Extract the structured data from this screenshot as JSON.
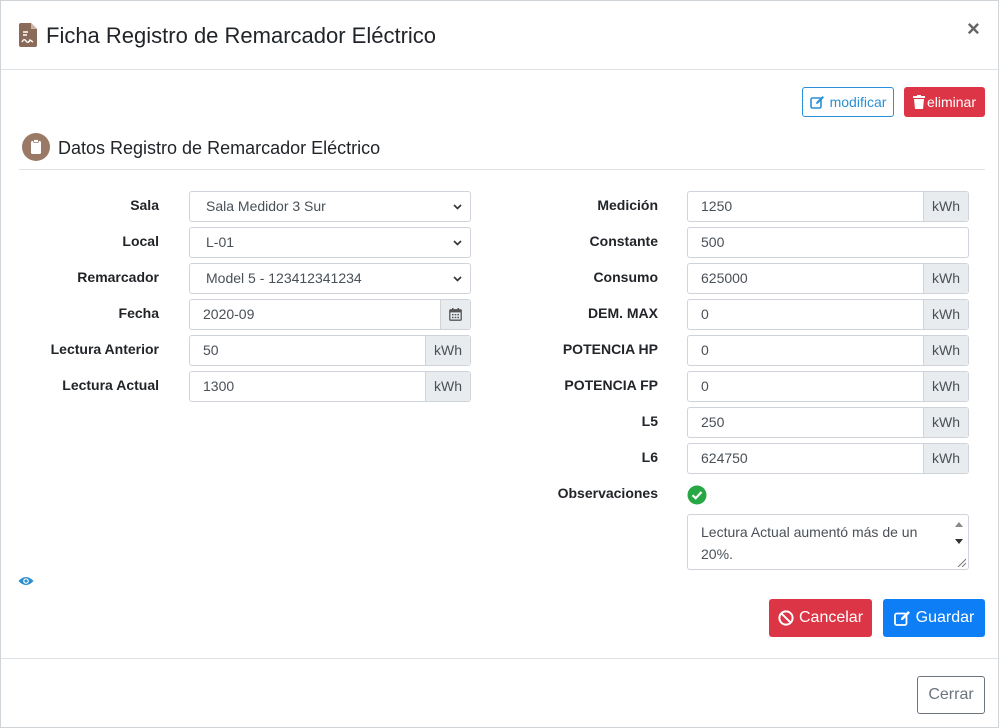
{
  "modal": {
    "title": "Ficha Registro de Remarcador Eléctrico",
    "close_symbol": "×",
    "title_icon": "file-signature-icon"
  },
  "actions": {
    "modify_label": "modificar",
    "delete_label": "eliminar"
  },
  "section": {
    "title": "Datos Registro de Remarcador Eléctrico",
    "icon": "clipboard-icon"
  },
  "left": {
    "sala": {
      "label": "Sala",
      "value": "Sala Medidor 3 Sur"
    },
    "local": {
      "label": "Local",
      "value": "L-01"
    },
    "remarcador": {
      "label": "Remarcador",
      "value": "Model 5 - 123412341234"
    },
    "fecha": {
      "label": "Fecha",
      "value": "2020-09"
    },
    "lectura_anterior": {
      "label": "Lectura Anterior",
      "value": "50",
      "unit": "kWh"
    },
    "lectura_actual": {
      "label": "Lectura Actual",
      "value": "1300",
      "unit": "kWh"
    }
  },
  "right": {
    "medicion": {
      "label": "Medición",
      "value": "1250",
      "unit": "kWh"
    },
    "constante": {
      "label": "Constante",
      "value": "500"
    },
    "consumo": {
      "label": "Consumo",
      "value": "625000",
      "unit": "kWh"
    },
    "dem_max": {
      "label": "DEM. MAX",
      "value": "0",
      "unit": "kWh"
    },
    "potencia_hp": {
      "label": "POTENCIA HP",
      "value": "0",
      "unit": "kWh"
    },
    "potencia_fp": {
      "label": "POTENCIA FP",
      "value": "0",
      "unit": "kWh"
    },
    "l5": {
      "label": "L5",
      "value": "250",
      "unit": "kWh"
    },
    "l6": {
      "label": "L6",
      "value": "624750",
      "unit": "kWh"
    },
    "observaciones": {
      "label": "Observaciones",
      "text": "Lectura Actual aumentó más de un 20%."
    }
  },
  "footer": {
    "cancel_label": "Cancelar",
    "save_label": "Guardar",
    "close_label": "Cerrar"
  },
  "colors": {
    "primary": "#0d7ef5",
    "danger": "#dc3545",
    "info_outline": "#2a8fd6",
    "success": "#28a745"
  }
}
